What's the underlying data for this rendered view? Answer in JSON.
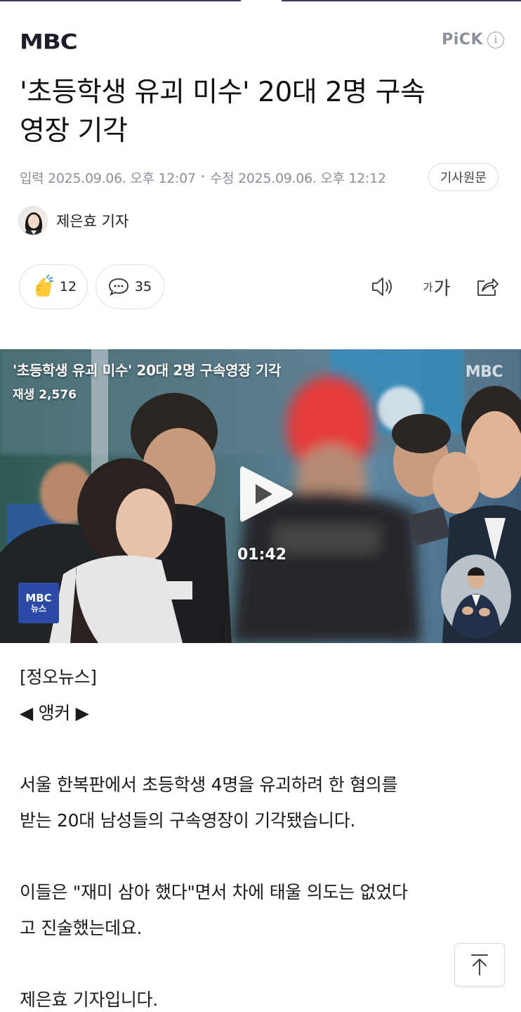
{
  "header": {
    "logo_text": "MBC",
    "pick_label": "PiCK",
    "pick_info_glyph": "i"
  },
  "article": {
    "title_line1": "'초등학생 유괴 미수' 20대 2명 구속",
    "title_line2": "영장 기각",
    "published": "입력 2025.09.06. 오후 12:07",
    "modified": "수정 2025.09.06. 오후 12:12",
    "meta_separator": "•",
    "origin_button": "기사원문",
    "reporter": "제은효 기자"
  },
  "actions": {
    "like_count": "12",
    "comment_count": "35",
    "font_small": "가",
    "font_large": "가",
    "icons": [
      "clap-icon",
      "speech-bubble-icon",
      "speaker-icon",
      "font-size-icon",
      "share-icon"
    ]
  },
  "video": {
    "title": "'초등학생 유괴 미수' 20대 2명 구속영장 기각",
    "views": "재생 2,576",
    "watermark": "MBC",
    "duration": "01:42",
    "badge_line1": "MBC",
    "badge_line2": "뉴스"
  },
  "body": {
    "section": "[정오뉴스]",
    "anchor": "◀ 앵커 ▶",
    "para1_line1": "서울 한복판에서 초등학생 4명을 유괴하려 한 혐의를",
    "para1_line2": "받는 20대 남성들의 구속영장이 기각됐습니다.",
    "para2_line1": "이들은 \"재미 삼아 했다\"면서 차에 태울 의도는 없었다",
    "para2_line2": "고 진술했는데요.",
    "para3_line1": "제은효 기자입니다."
  },
  "colors": {
    "top_bar": "#39395f",
    "meta_gray": "#8b8f98",
    "badge_blue": "#2b4aa6"
  }
}
